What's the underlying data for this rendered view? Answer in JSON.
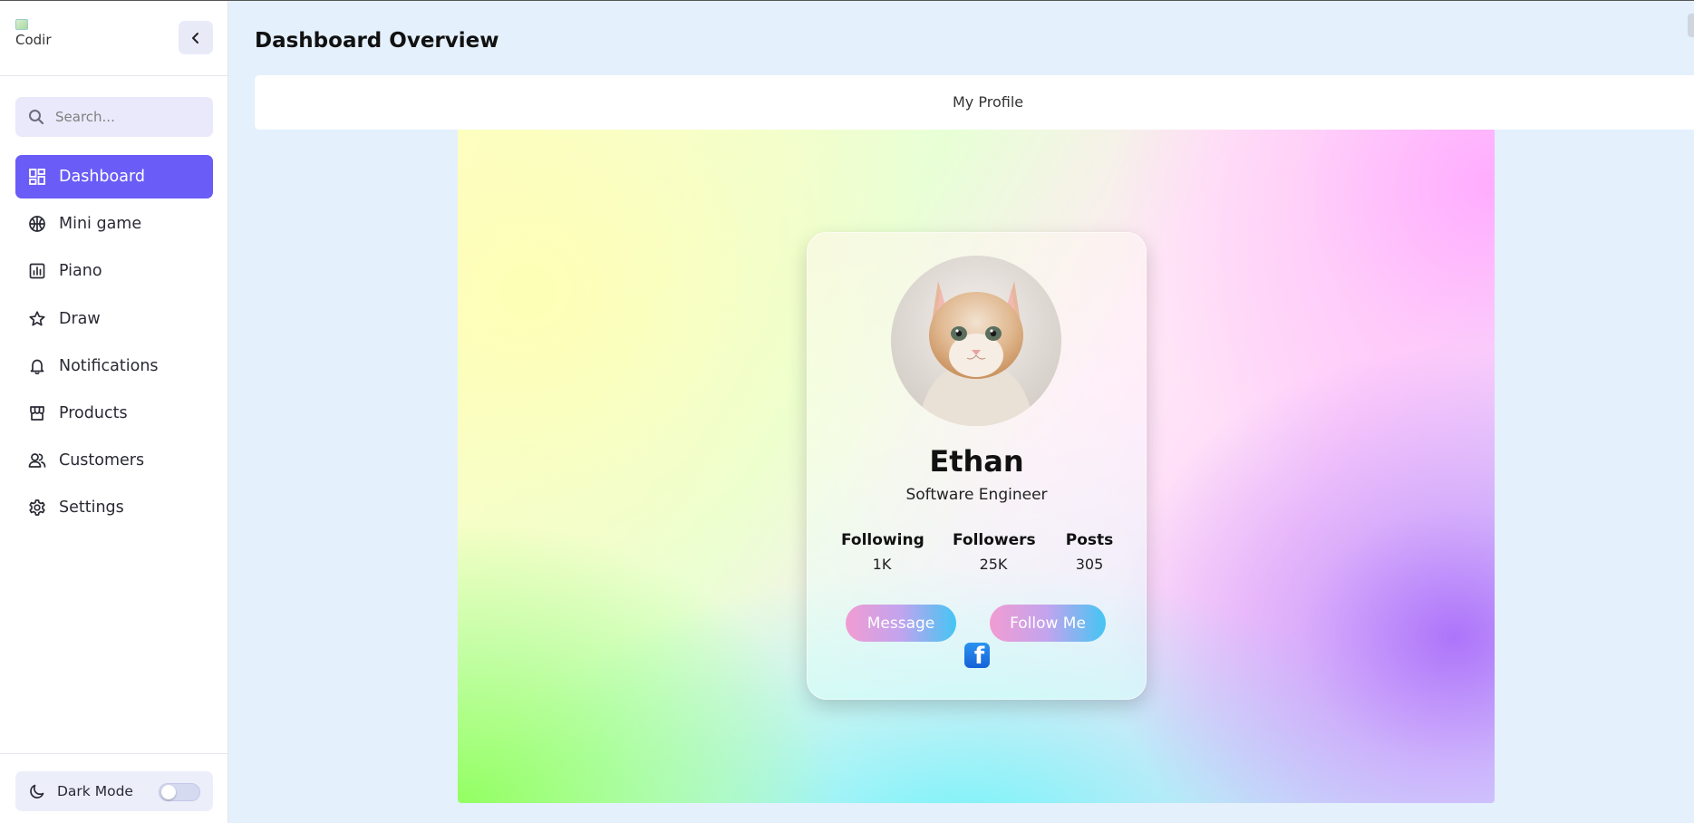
{
  "sidebar": {
    "logo_alt": "Codir",
    "search": {
      "placeholder": "Search..."
    },
    "items": [
      {
        "label": "Dashboard",
        "icon": "dashboard-icon",
        "active": true
      },
      {
        "label": "Mini game",
        "icon": "basketball-icon",
        "active": false
      },
      {
        "label": "Piano",
        "icon": "chart-icon",
        "active": false
      },
      {
        "label": "Draw",
        "icon": "star-icon",
        "active": false
      },
      {
        "label": "Notifications",
        "icon": "bell-icon",
        "active": false
      },
      {
        "label": "Products",
        "icon": "store-icon",
        "active": false
      },
      {
        "label": "Customers",
        "icon": "users-icon",
        "active": false
      },
      {
        "label": "Settings",
        "icon": "gear-icon",
        "active": false
      }
    ],
    "dark_mode": {
      "label": "Dark Mode",
      "enabled": false
    }
  },
  "header": {
    "title": "Dashboard Overview"
  },
  "tabs": [
    {
      "label": "My Profile"
    }
  ],
  "profile": {
    "name": "Ethan",
    "role": "Software Engineer",
    "avatar": "kitten-photo",
    "stats": [
      {
        "label": "Following",
        "value": "1K"
      },
      {
        "label": "Followers",
        "value": "25K"
      },
      {
        "label": "Posts",
        "value": "305"
      }
    ],
    "buttons": {
      "message": "Message",
      "follow": "Follow Me"
    },
    "social": "facebook-icon"
  },
  "colors": {
    "accent": "#6a5cf6",
    "background": "#e4f0fc",
    "button_gradient_start": "#f29cd2",
    "button_gradient_end": "#44c5f3",
    "facebook": "#1877f2"
  }
}
